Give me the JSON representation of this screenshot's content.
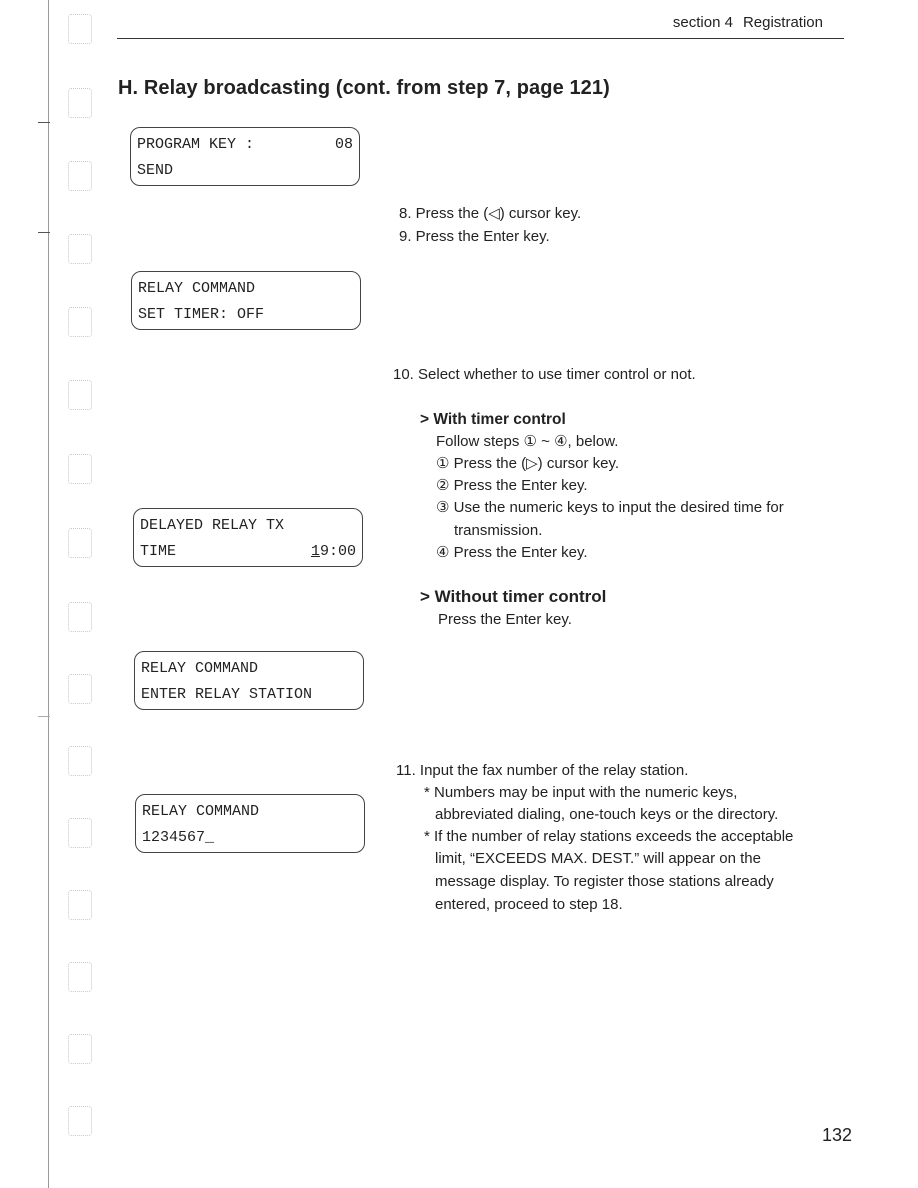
{
  "header": {
    "section": "section 4",
    "chapter": "Registration"
  },
  "title": "H. Relay broadcasting  (cont. from step 7, page 121)",
  "displays": [
    {
      "line1_left": "PROGRAM KEY :",
      "line1_right": "08",
      "line2_left": "SEND",
      "line2_right": ""
    },
    {
      "line1_left": "RELAY COMMAND",
      "line1_right": "",
      "line2_left": "SET TIMER: OFF",
      "line2_right": ""
    },
    {
      "line1_left": "DELAYED RELAY TX",
      "line1_right": "",
      "line2_left": "TIME",
      "line2_cursor_char": "1",
      "line2_right_rest": "9:00"
    },
    {
      "line1_left": "RELAY COMMAND",
      "line1_right": "",
      "line2_left": "ENTER RELAY STATION",
      "line2_right": ""
    },
    {
      "line1_left": "RELAY COMMAND",
      "line1_right": "",
      "line2_left": "1234567_",
      "line2_right": ""
    }
  ],
  "steps": {
    "s8": "8. Press the (◁) cursor key.",
    "s9": "9. Press the Enter key.",
    "s10": "10. Select whether to use timer control or not.",
    "with_timer": {
      "heading": "> With timer control",
      "intro": "Follow steps ① ~ ④, below.",
      "items": [
        "① Press the (▷) cursor key.",
        "② Press the Enter key.",
        "③ Use the numeric keys to input the desired time for",
        "transmission.",
        "④ Press the Enter key."
      ]
    },
    "without_timer": {
      "heading": "> Without timer control",
      "text": "Press the Enter key."
    },
    "s11": "11. Input the fax number of the relay station.",
    "s11_notes": [
      "* Numbers may be input with the numeric keys,",
      "abbreviated dialing, one-touch keys or the directory.",
      "* If the number of relay stations exceeds the acceptable",
      "limit, “EXCEEDS MAX. DEST.” will appear on the",
      "message display. To register those stations already",
      "entered, proceed to step 18."
    ]
  },
  "page_number": "132"
}
